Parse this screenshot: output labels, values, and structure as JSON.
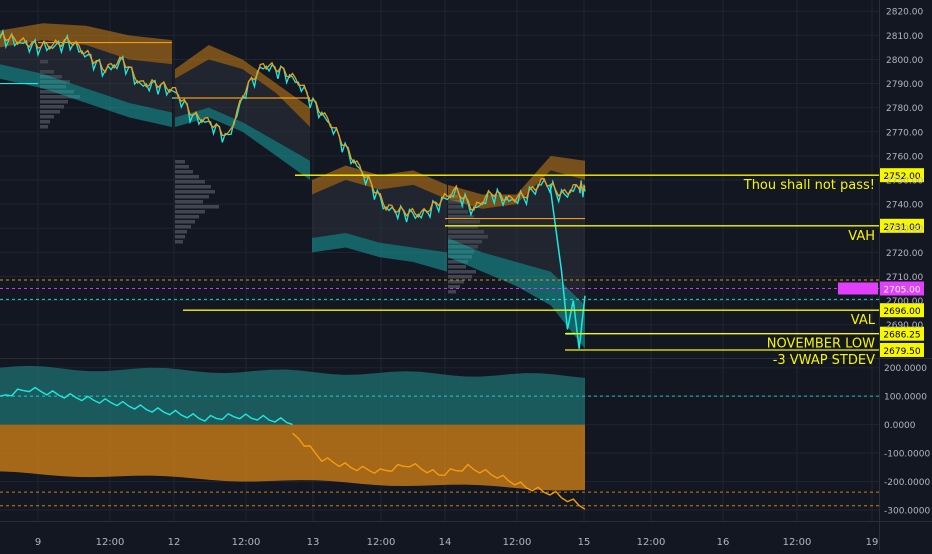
{
  "chart_data": [
    {
      "type": "line",
      "panel": "price",
      "y_axis": {
        "ticks": [
          2690,
          2700,
          2710,
          2720,
          2730,
          2740,
          2750,
          2760,
          2770,
          2780,
          2790,
          2800,
          2810,
          2820
        ],
        "tick_labels": [
          "2690.00",
          "2700.00",
          "2710.00",
          "2720.00",
          "2730.00",
          "2740.00",
          "2750.00",
          "2760.00",
          "2770.00",
          "2780.00",
          "2790.00",
          "2800.00",
          "2810.00",
          "2820.00"
        ],
        "ylim": [
          2677,
          2823
        ]
      },
      "x_axis": {
        "tick_labels": [
          "9",
          "12:00",
          "12",
          "12:00",
          "13",
          "12:00",
          "14",
          "12:00",
          "15",
          "12:00",
          "16",
          "12:00",
          "19"
        ]
      },
      "grid": true,
      "horizontal_levels": [
        {
          "value": 2752.0,
          "label": "2752.00",
          "annotation": "Thou shall not pass!",
          "color": "#f7f700"
        },
        {
          "value": 2731.0,
          "label": "2731.00",
          "annotation": "VAH",
          "color": "#f7f700"
        },
        {
          "value": 2696.0,
          "label": "2696.00",
          "annotation": "VAL",
          "color": "#f7f700"
        },
        {
          "value": 2686.25,
          "label": "2686.25",
          "annotation": "NOVEMBER LOW",
          "color": "#f7f700"
        },
        {
          "value": 2679.5,
          "label": "2679.50",
          "annotation": "-3 VWAP STDEV",
          "color": "#f7f700"
        }
      ],
      "price_tags": [
        {
          "value": 2705.0,
          "label": "2705.00",
          "color": "#e040fb"
        }
      ],
      "dashed_levels": [
        {
          "value": 2708.5,
          "color": "#f39c12"
        },
        {
          "value": 2705.0,
          "color": "#e040fb"
        },
        {
          "value": 2700.5,
          "color": "#1de9e0"
        }
      ],
      "series": [
        {
          "color": "#f39c12",
          "x": [
            0,
            0.03,
            0.06,
            0.09,
            0.12,
            0.15,
            0.18,
            0.21,
            0.24,
            0.27,
            0.3,
            0.33,
            0.36,
            0.39,
            0.42,
            0.45,
            0.48,
            0.51,
            0.54,
            0.57,
            0.6,
            0.63,
            0.66,
            0.69,
            0.72,
            0.75,
            0.78,
            0.81,
            0.84,
            0.87,
            0.9,
            0.93,
            0.96,
            0.99,
            1.0
          ],
          "values": [
            2810,
            2808,
            2806,
            2806,
            2808,
            2802,
            2796,
            2800,
            2790,
            2790,
            2787,
            2777,
            2774,
            2768,
            2788,
            2798,
            2796,
            2791,
            2781,
            2772,
            2760,
            2750,
            2739,
            2737,
            2736,
            2741,
            2746,
            2738,
            2745,
            2742,
            2744,
            2750,
            2744,
            2748,
            2746
          ]
        }
      ]
    },
    {
      "type": "area",
      "panel": "oscillator",
      "y_axis": {
        "ticks": [
          200,
          100,
          0,
          -100,
          -200,
          -300
        ],
        "tick_labels": [
          "200.0000",
          "100.0000",
          "0.0000",
          "-100.0000",
          "-200.0000",
          "-300.0000"
        ],
        "ylim": [
          -335,
          220
        ]
      },
      "dashed_levels": [
        {
          "value": 100,
          "color": "#1de9e0"
        },
        {
          "value": -237,
          "color": "#f39c12"
        },
        {
          "value": -285,
          "color": "#f39c12"
        }
      ],
      "series": [
        {
          "color": "#1de9e0",
          "x": [
            0,
            0.05,
            0.1,
            0.15,
            0.2,
            0.25,
            0.3,
            0.35,
            0.4,
            0.45,
            0.5
          ],
          "values": [
            100,
            125,
            105,
            90,
            75,
            55,
            40,
            20,
            30,
            22,
            8
          ]
        },
        {
          "color": "#f39c12",
          "x": [
            0.5,
            0.55,
            0.6,
            0.65,
            0.7,
            0.75,
            0.8,
            0.85,
            0.9,
            0.95,
            1.0
          ],
          "values": [
            -30,
            -120,
            -150,
            -165,
            -140,
            -175,
            -150,
            -180,
            -220,
            -245,
            -290
          ]
        }
      ]
    }
  ]
}
